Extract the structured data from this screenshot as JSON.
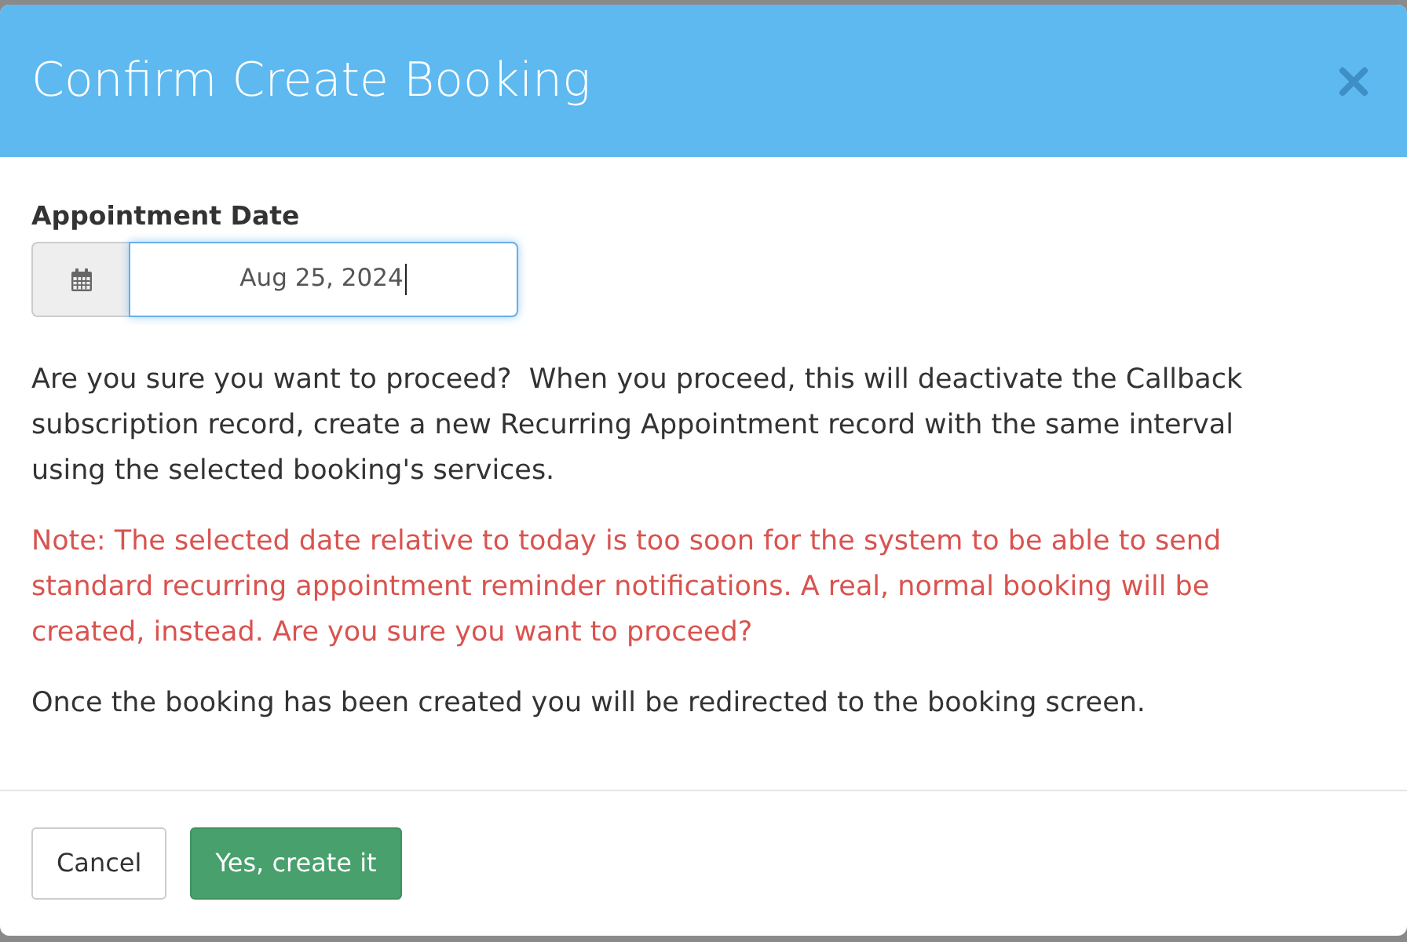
{
  "dialog": {
    "title": "Confirm Create Booking"
  },
  "date_field": {
    "label": "Appointment Date",
    "value": "Aug 25, 2024",
    "focused": true
  },
  "paragraphs": [
    {
      "kind": "normal",
      "text": "Are you sure you want to proceed?  When you proceed, this will deactivate the Callback subscription record, create a new Recurring Appointment record with the same interval using the selected booking's services."
    },
    {
      "kind": "warning",
      "text": "Note: The selected date relative to today is too soon for the system to be able to send standard recurring appointment reminder notifications. A real, normal booking will be created, instead. Are you sure you want to proceed?"
    },
    {
      "kind": "normal",
      "text": "Once the booking has been created you will be redirected to the booking screen."
    }
  ],
  "buttons": [
    {
      "kind": "default",
      "label": "Cancel"
    },
    {
      "kind": "success",
      "label": "Yes, create it"
    }
  ]
}
